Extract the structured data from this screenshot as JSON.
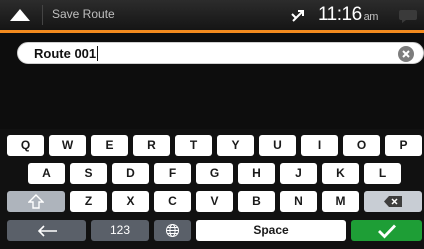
{
  "header": {
    "title": "Save Route",
    "time": "11:16",
    "ampm": "am",
    "icons": [
      "back-arrow-icon",
      "gps-signal-icon",
      "message-icon"
    ]
  },
  "input": {
    "value": "Route 001",
    "clear_icon": "clear-icon"
  },
  "keyboard": {
    "row1": [
      "Q",
      "W",
      "E",
      "R",
      "T",
      "Y",
      "U",
      "I",
      "O",
      "P"
    ],
    "row2": [
      "A",
      "S",
      "D",
      "F",
      "G",
      "H",
      "J",
      "K",
      "L"
    ],
    "row3": [
      "Z",
      "X",
      "C",
      "V",
      "B",
      "N",
      "M"
    ],
    "shift_icon": "shift-icon",
    "backspace_icon": "backspace-icon",
    "back_icon": "back-arrow-icon",
    "numbers_label": "123",
    "globe_icon": "globe-icon",
    "space_label": "Space",
    "enter_icon": "checkmark-icon"
  },
  "colors": {
    "accent": "#f28a1e",
    "confirm": "#1e9e36"
  }
}
